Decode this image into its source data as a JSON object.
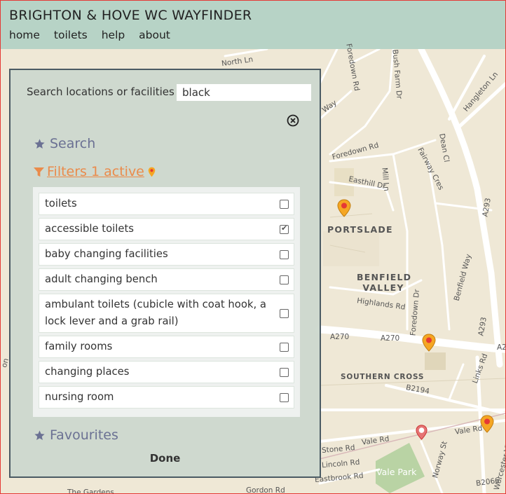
{
  "header": {
    "title": "BRIGHTON & HOVE WC WAYFINDER",
    "nav": [
      "home",
      "toilets",
      "help",
      "about"
    ]
  },
  "map": {
    "road_labels": [
      "North Ln",
      "Foredown Rd",
      "Bush Farm Dr",
      "Hangleton Ln",
      "Way",
      "Foredown Rd",
      "Easthill Dr",
      "Mill Ln",
      "Fairway Cres",
      "Dean Cl",
      "A293",
      "Highlands Rd",
      "Foredown Dr",
      "Benfield Way",
      "A270",
      "A270",
      "A293",
      "B2194",
      "Links Rd",
      "Vale Rd",
      "Vale Rd",
      "Worcester Vil",
      "Norway St",
      "Stone Rd",
      "Lincoln Rd",
      "Eastbrook Rd",
      "Gordon Rd",
      "B2066",
      "A2",
      "The Gardens",
      "on"
    ],
    "place_labels": [
      "PORTSLADE",
      "BENFIELD\nVALLEY",
      "SOUTHERN CROSS"
    ],
    "park_label": "Vale Park",
    "pin_color": "#f5a623",
    "pin_dot_color": "#e53935"
  },
  "panel": {
    "search_label": "Search locations or facilities",
    "search_value": "black",
    "sections": {
      "search": "Search",
      "filters": "Filters 1 active",
      "favourites": "Favourites"
    },
    "filters": [
      {
        "label": "toilets",
        "checked": false
      },
      {
        "label": "accessible toilets",
        "checked": true
      },
      {
        "label": "baby changing facilities",
        "checked": false
      },
      {
        "label": "adult changing bench",
        "checked": false
      },
      {
        "label": "ambulant toilets (cubicle with coat hook, a lock lever and a grab rail)",
        "checked": false
      },
      {
        "label": "family rooms",
        "checked": false
      },
      {
        "label": "changing places",
        "checked": false
      },
      {
        "label": "nursing room",
        "checked": false
      }
    ],
    "done": "Done"
  },
  "colors": {
    "header_bg": "#b7d3c6",
    "panel_bg": "#cdd9ce",
    "section_blue": "#6b7193",
    "filters_orange": "#ea8b4b"
  }
}
